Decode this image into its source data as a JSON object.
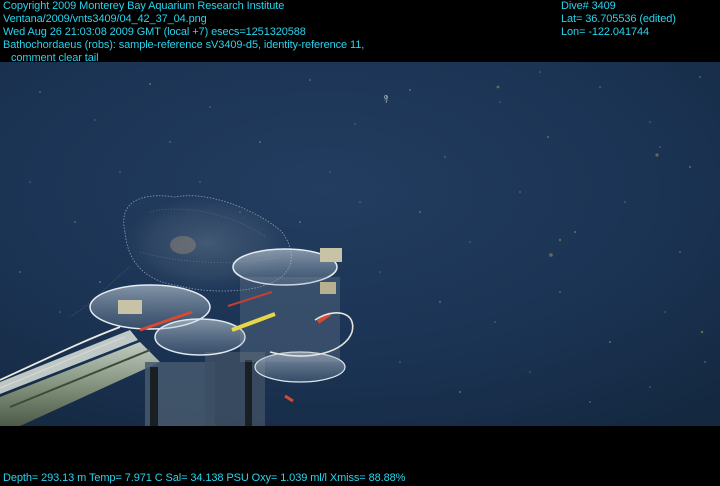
{
  "header_left": {
    "line1": "Copyright 2009 Monterey Bay Aquarium Research Institute",
    "line2": "Ventana/2009/vnts3409/04_42_37_04.png",
    "line3": "Wed Aug 26 21:03:08 2009 GMT (local +7)  esecs=1251320588",
    "line4": "Bathochordaeus (robs): sample-reference sV3409-d5, identity-reference 11,",
    "line5": "comment clear tail"
  },
  "header_right": {
    "dive": "Dive# 3409",
    "lat": "Lat= 36.705536 (edited)",
    "lon": "Lon= -122.041744"
  },
  "footer": {
    "readout": "Depth= 293.13 m  Temp= 7.971 C  Sal= 34.138 PSU  Oxy= 1.039 ml/l  Xmiss= 88.88%"
  },
  "colors": {
    "overlay_text": "#29d3ec",
    "water": "#1d3656",
    "frame": "#000000"
  }
}
